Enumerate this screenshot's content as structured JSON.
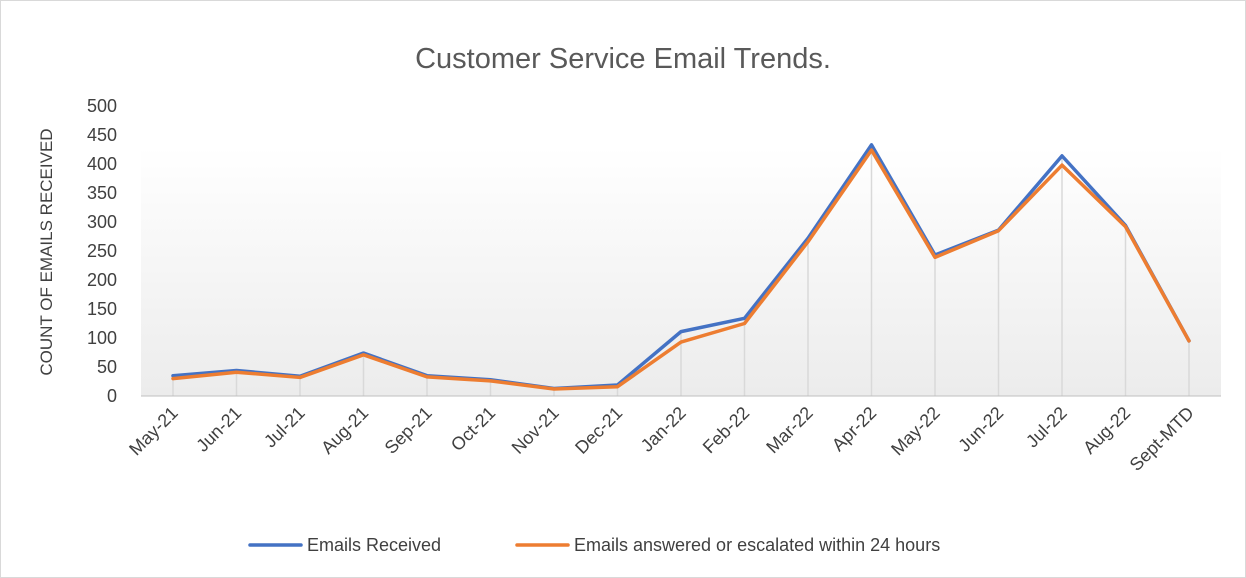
{
  "chart_data": {
    "type": "line",
    "title": "Customer Service Email Trends.",
    "xlabel": "",
    "ylabel": "COUNT OF EMAILS RECEIVED",
    "ylim": [
      0,
      500
    ],
    "yticks": [
      0,
      50,
      100,
      150,
      200,
      250,
      300,
      350,
      400,
      450,
      500
    ],
    "grid": false,
    "legend_position": "bottom",
    "categories": [
      "May-21",
      "Jun-21",
      "Jul-21",
      "Aug-21",
      "Sep-21",
      "Oct-21",
      "Nov-21",
      "Dec-21",
      "Jan-22",
      "Feb-22",
      "Mar-22",
      "Apr-22",
      "May-22",
      "Jun-22",
      "Jul-22",
      "Aug-22",
      "Sept-MTD"
    ],
    "series": [
      {
        "name": "Emails Received",
        "color": "#4472c4",
        "values": [
          35,
          44,
          34,
          74,
          35,
          28,
          13,
          19,
          111,
          134,
          272,
          433,
          243,
          286,
          414,
          294,
          95
        ]
      },
      {
        "name": "Emails answered or escalated within 24 hours",
        "color": "#ed7d31",
        "values": [
          30,
          41,
          32,
          71,
          33,
          26,
          12,
          16,
          93,
          125,
          266,
          424,
          239,
          285,
          398,
          292,
          95
        ]
      }
    ]
  }
}
